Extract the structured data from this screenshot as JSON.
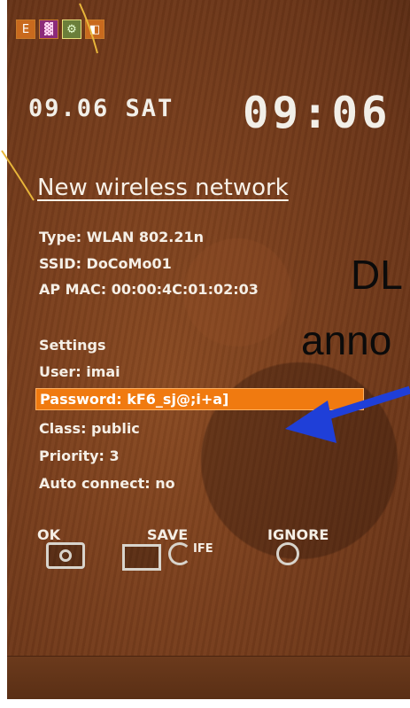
{
  "status_bar": {
    "icons": [
      "app-icon-orange",
      "app-icon-purple",
      "app-icon-green",
      "app-icon-orange-2"
    ],
    "icon_glyphs": [
      "E",
      "▓",
      "⚙",
      "◧"
    ]
  },
  "clock": {
    "date": "09.06 SAT",
    "time": "09:06"
  },
  "dialog": {
    "title": "New wireless network",
    "type": "Type: WLAN 802.21n",
    "ssid": "SSID: DoCoMo01",
    "ap_mac": "AP MAC: 00:00:4C:01:02:03",
    "settings_heading": "Settings",
    "user": "User: imai",
    "password": "Password: kF6_sj@;i+a]",
    "class": "Class: public",
    "priority": "Priority: 3",
    "auto_connect": "Auto connect: no"
  },
  "actions": {
    "ok": "OK",
    "save": "SAVE",
    "ignore": "IGNORE",
    "file_suffix": "IFE"
  },
  "annotation": {
    "label_line1": "DL",
    "label_line2": "anno",
    "arrow_color": "#1f3fd8"
  },
  "colors": {
    "highlight": "#f07a10",
    "background": "#7a3f1d"
  }
}
